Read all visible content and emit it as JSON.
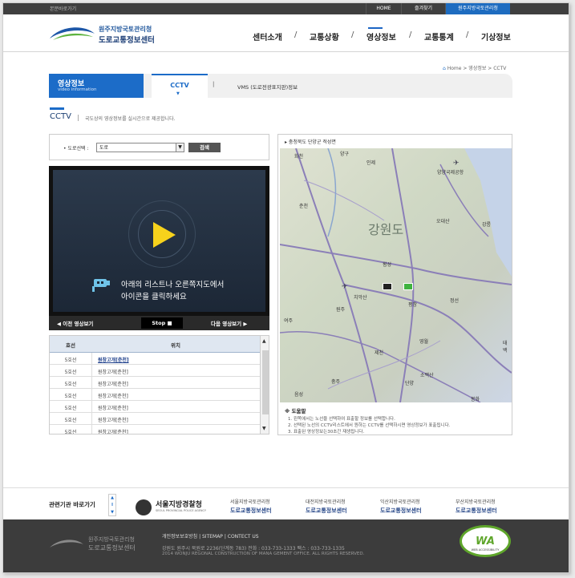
{
  "topbar": {
    "skip": "본문바로가기",
    "home": "HOME",
    "favorites": "즐겨찾기",
    "org": "원주지방국토관리청"
  },
  "header": {
    "logo_line1": "원주지방국토관리청",
    "logo_line2": "도로교통정보센터",
    "nav": [
      "센터소개",
      "교통상황",
      "영상정보",
      "교통통계",
      "기상정보"
    ],
    "active_nav": "영상정보"
  },
  "breadcrumb": "Home > 영상정보 > CCTV",
  "section": {
    "title": "영상정보",
    "subtitle": "video information",
    "tabs": [
      "CCTV",
      "VMS (도로전광표지판)정보"
    ],
    "separator": "|"
  },
  "page": {
    "title": "CCTV",
    "desc": "국도상의 영상정보를 실시간으로 제공합니다."
  },
  "filter": {
    "label": "• 도로선택 :",
    "value": "도로",
    "button": "검색"
  },
  "video": {
    "message_line1": "아래의 리스트나 오른쪽지도에서",
    "message_line2": "아이콘을 클릭하세요",
    "prev": "◀ 이전 영상보기",
    "stop": "Stop ■",
    "next": "다음 영상보기 ▶"
  },
  "table": {
    "headers": [
      "호선",
      "위치"
    ],
    "rows": [
      [
        "5호선",
        "원창고개[춘천]"
      ],
      [
        "5호선",
        "원창고개[춘천]"
      ],
      [
        "5호선",
        "원창고개[춘천]"
      ],
      [
        "5호선",
        "원창고개[춘천]"
      ],
      [
        "5호선",
        "원창고개[춘천]"
      ],
      [
        "5호선",
        "원창고개[춘천]"
      ],
      [
        "5호선",
        "원창고개[춘천]"
      ]
    ]
  },
  "map": {
    "title": "▸ 충청북도 단양군 적성면",
    "region": "강원도",
    "places": [
      {
        "name": "화천"
      },
      {
        "name": "양구"
      },
      {
        "name": "인제"
      },
      {
        "name": "양양국제공항"
      },
      {
        "name": "춘천"
      },
      {
        "name": "오대산"
      },
      {
        "name": "강릉"
      },
      {
        "name": "횡성"
      },
      {
        "name": "원주"
      },
      {
        "name": "치악산"
      },
      {
        "name": "평창"
      },
      {
        "name": "정선"
      },
      {
        "name": "여주"
      },
      {
        "name": "제천"
      },
      {
        "name": "충주"
      },
      {
        "name": "영월"
      },
      {
        "name": "단양"
      },
      {
        "name": "소백산"
      },
      {
        "name": "음성"
      },
      {
        "name": "봉화"
      },
      {
        "name": "태백"
      }
    ],
    "help_title": "※ 도움말",
    "help": [
      "1. 왼쪽에서는 노선을 선택하여 표출할 정보를 선택합니다.",
      "2. 선택된 노선의 CCTV리스트에서 원하는 CCTV를 선택하시면 영상정보가 표출됩니다.",
      "3. 표출된 영상정보는30초간 재생됩니다."
    ]
  },
  "footer": {
    "related_label": "관련기관 바로가기",
    "police_name": "서울지방경찰청",
    "police_sub": "SEOUL PROVINCIAL POLICE AGENCY",
    "orgs": [
      {
        "line1": "서울지방국토관리청",
        "line2": "도로교통정보센터"
      },
      {
        "line1": "대전지방국토관리청",
        "line2": "도로교통정보센터"
      },
      {
        "line1": "익산지방국토관리청",
        "line2": "도로교통정보센터"
      },
      {
        "line1": "부산지방국토관리청",
        "line2": "도로교통정보센터"
      }
    ],
    "logo_line1": "원주지방국토관리청",
    "logo_line2": "도로교통정보센터",
    "links": "개인정보보호방침  |  SITEMAP  |  CONTECT US",
    "address": "강원도 원주시 북원로 2236(단계동 783)     전화 : 033-733-1333     팩스 : 033-733-1335",
    "copyright": "2014 WONJU REGONAL CONSTRUCTION OF MANA GEMENT OFFICE. ALL RIGHTS RESERVED.",
    "wa_mark": "WA",
    "wa_text": "WEB ACCESSIBILITY"
  }
}
